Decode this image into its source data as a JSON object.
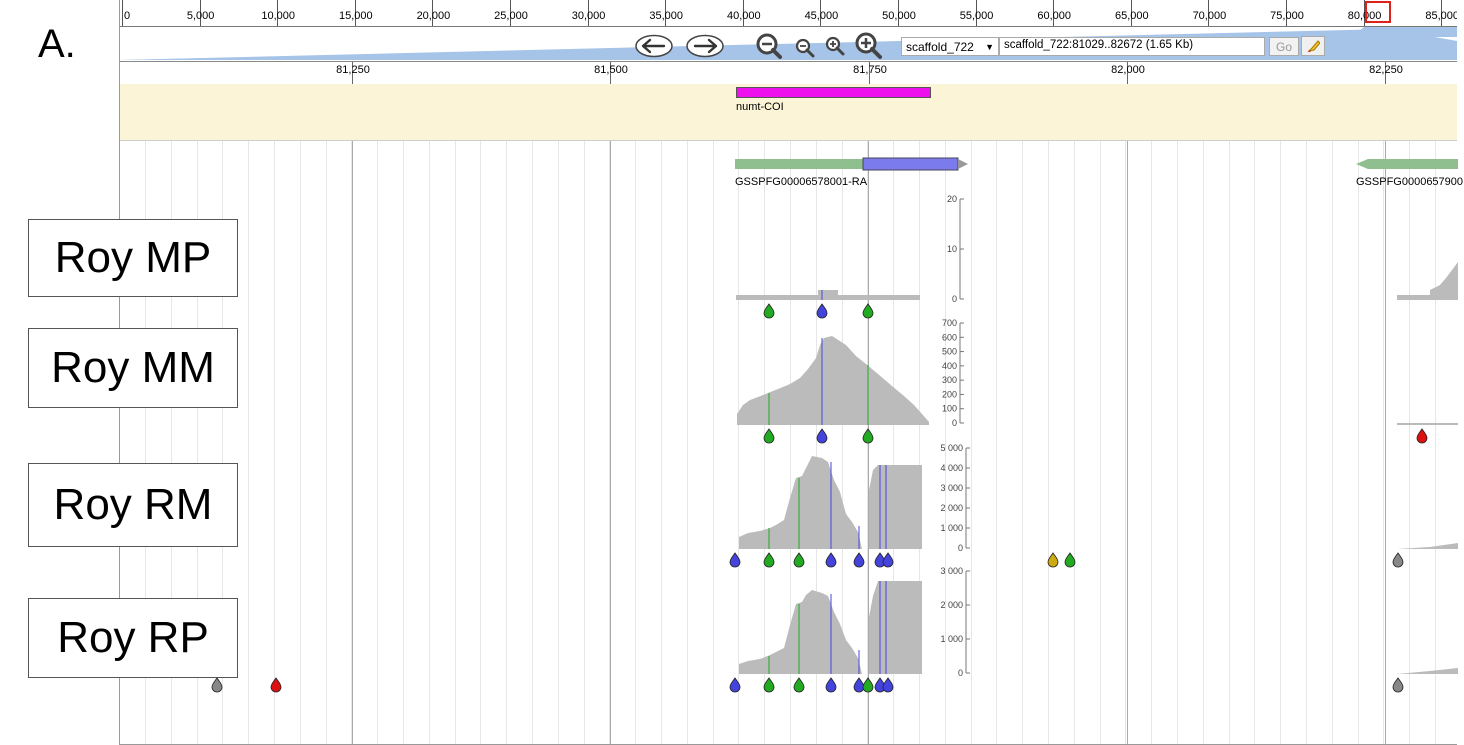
{
  "panel_letter": "A.",
  "overview": {
    "ticks": [
      "0",
      "5,000",
      "10,000",
      "15,000",
      "20,000",
      "25,000",
      "30,000",
      "35,000",
      "40,000",
      "45,000",
      "50,000",
      "55,000",
      "60,000",
      "65,000",
      "70,000",
      "75,000",
      "80,000",
      "85,000"
    ]
  },
  "navigation": {
    "back_icon": "arrow-left-icon",
    "forward_icon": "arrow-right-icon",
    "zoom_out_large_icon": "zoom-out-large-icon",
    "zoom_out_small_icon": "zoom-out-small-icon",
    "zoom_in_small_icon": "zoom-in-small-icon",
    "zoom_in_large_icon": "zoom-in-large-icon",
    "reference_sequence": "scaffold_722",
    "location_value": "scaffold_722:81029..82672 (1.65 Kb)",
    "go_label": "Go",
    "highlight_icon": "highlighter-icon"
  },
  "detail_ruler": {
    "ticks": [
      "81,250",
      "81,500",
      "81,750",
      "82,000",
      "82,250"
    ]
  },
  "features": {
    "numt_label": "numt-COI",
    "numt_color": "#ee11ee",
    "gene1_label": "GSSPFG00006578001-RA",
    "gene2_label": "GSSPFG0000657900",
    "utr_color": "#8fbf8f",
    "cds_color": "#7b7bee"
  },
  "tracks": [
    {
      "name": "Roy MP",
      "scale": [
        "20",
        "10",
        "0"
      ]
    },
    {
      "name": "Roy MM",
      "scale": [
        "700",
        "600",
        "500",
        "400",
        "300",
        "200",
        "100",
        "0"
      ]
    },
    {
      "name": "Roy RM",
      "scale": [
        "5 000",
        "4 000",
        "3 000",
        "2 000",
        "1 000",
        "0"
      ]
    },
    {
      "name": "Roy RP",
      "scale": [
        "3 000",
        "2 000",
        "1 000",
        "0"
      ]
    }
  ],
  "colors": {
    "coverage": "#bbbbbb",
    "snp_green": "#22aa22",
    "snp_blue": "#4444dd",
    "snp_red": "#dd1111",
    "snp_gray": "#888888",
    "snp_yellow": "#ccaa11"
  }
}
